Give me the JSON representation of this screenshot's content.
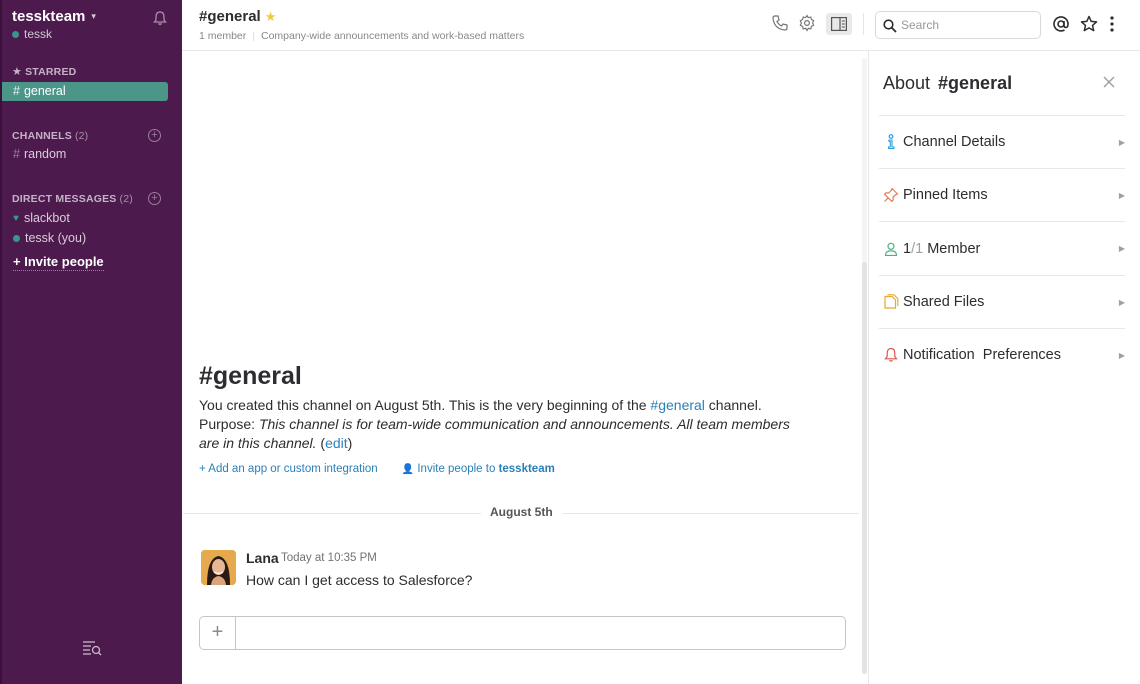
{
  "sidebar": {
    "team_name": "tesskteam",
    "user_name": "tessk",
    "starred_label": "STARRED",
    "starred_channel": "general",
    "channels_label": "CHANNELS",
    "channels_count": "(2)",
    "channels": [
      "random"
    ],
    "dm_label": "DIRECT MESSAGES",
    "dm_count": "(2)",
    "dms": [
      "slackbot",
      "tessk (you)"
    ],
    "invite_label": "+ Invite people"
  },
  "header": {
    "channel_title": "#general",
    "member_count": "1 member",
    "purpose": "Company-wide announcements and work-based matters",
    "search_placeholder": "Search"
  },
  "intro": {
    "title": "#general",
    "line1_a": "You created this channel on August 5th. This is the very beginning of the ",
    "line1_link": "#general",
    "line1_b": " channel.",
    "purpose_label": "Purpose: ",
    "purpose_text": "This channel is for team-wide communication and announcements. All team members are in this channel.",
    "edit_open": " (",
    "edit_link": "edit",
    "edit_close": ")",
    "add_app": "+ Add an app or custom integration",
    "invite_prefix": "Invite people to ",
    "invite_team": "tesskteam"
  },
  "messages": {
    "date_divider": "August 5th",
    "author": "Lana",
    "time": "Today at 10:35 PM",
    "text": "How can I get access to Salesforce?"
  },
  "composer": {
    "plus": "+"
  },
  "rpanel": {
    "about_label": "About",
    "about_channel": "#general",
    "items": [
      {
        "label": "Channel Details"
      },
      {
        "label": "Pinned Items"
      },
      {
        "label": " Member",
        "count_a": "1",
        "count_b": "/1"
      },
      {
        "label": "Shared Files"
      },
      {
        "label": "Notification  Preferences"
      }
    ]
  },
  "colors": {
    "sidebar_bg": "#4d1a4e",
    "active_channel": "#4c9689",
    "link": "#2a80b9",
    "star": "#f2c744"
  }
}
